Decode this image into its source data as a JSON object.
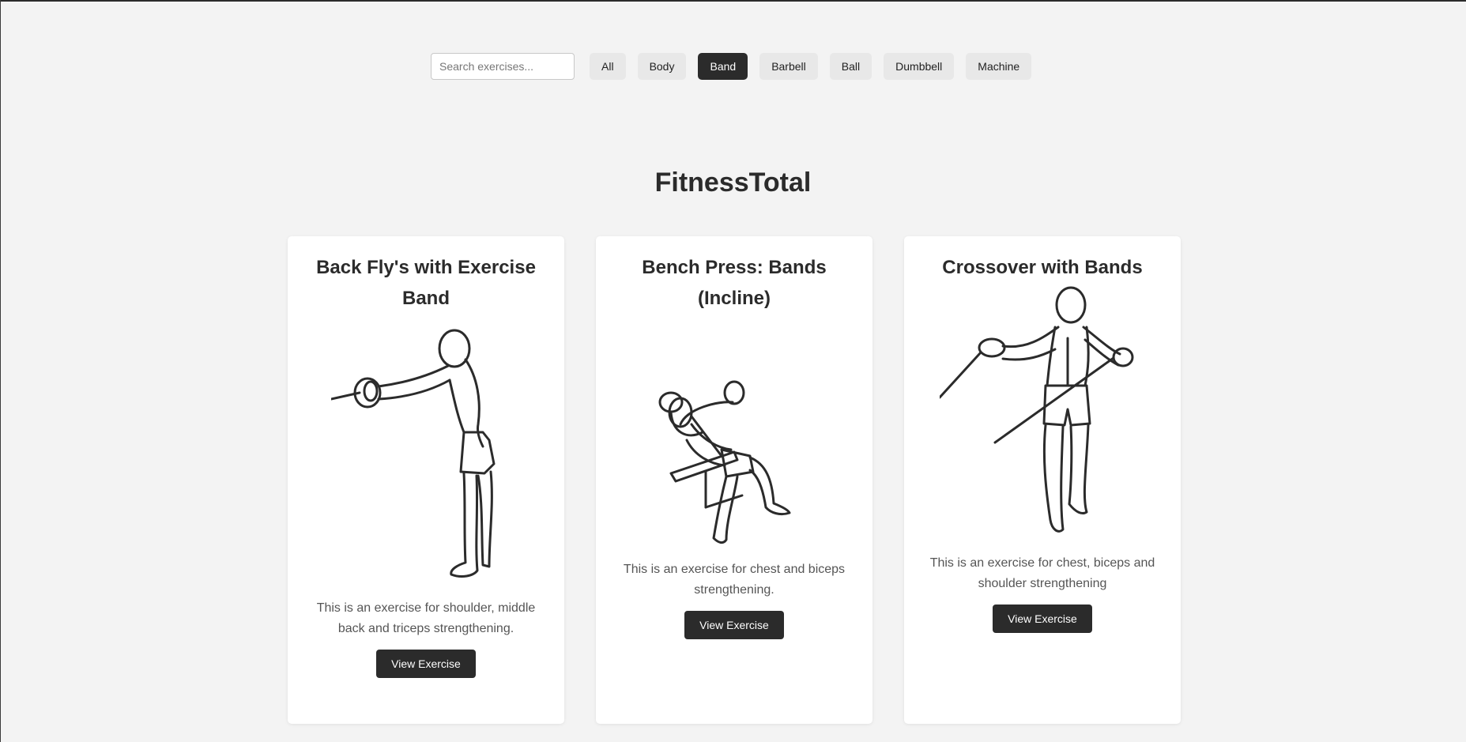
{
  "search": {
    "placeholder": "Search exercises..."
  },
  "filters": [
    {
      "label": "All",
      "active": false
    },
    {
      "label": "Body",
      "active": false
    },
    {
      "label": "Band",
      "active": true
    },
    {
      "label": "Barbell",
      "active": false
    },
    {
      "label": "Ball",
      "active": false
    },
    {
      "label": "Dumbbell",
      "active": false
    },
    {
      "label": "Machine",
      "active": false
    }
  ],
  "site": {
    "title": "FitnessTotal"
  },
  "cards": [
    {
      "title": "Back Fly's with Exercise Band",
      "description": "This is an exercise for shoulder, middle back and triceps strengthening.",
      "button_label": "View Exercise",
      "illustration": "standing-band-back-fly"
    },
    {
      "title": "Bench Press: Bands (Incline)",
      "description": "This is an exercise for chest and biceps strengthening.",
      "button_label": "View Exercise",
      "illustration": "incline-bench-press-bands"
    },
    {
      "title": "Crossover with Bands",
      "description": "This is an exercise for chest, biceps and shoulder strengthening",
      "button_label": "View Exercise",
      "illustration": "band-crossover"
    }
  ],
  "colors": {
    "background": "#f3f3f3",
    "accent": "#2b2b2b",
    "card": "#ffffff"
  }
}
